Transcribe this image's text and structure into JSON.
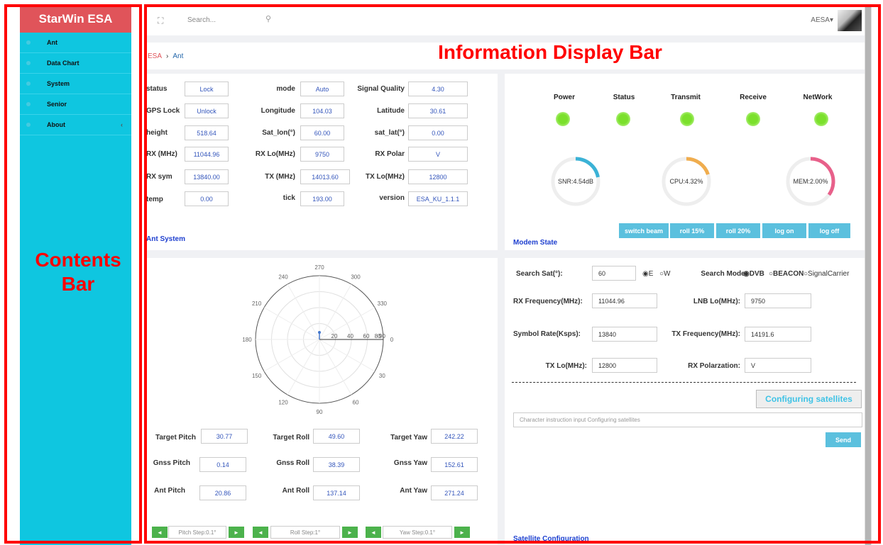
{
  "sidebar": {
    "brand": "StarWin ESA",
    "items": [
      {
        "label": "Ant"
      },
      {
        "label": "Data Chart"
      },
      {
        "label": "System"
      },
      {
        "label": "Senior"
      },
      {
        "label": "About",
        "chevron": "‹"
      }
    ]
  },
  "annotations": {
    "contents": "Contents Bar",
    "information": "Information Display Bar"
  },
  "topbar": {
    "search_placeholder": "Search...",
    "user": "AESA▾"
  },
  "breadcrumb": {
    "items": [
      "ESA",
      "Ant"
    ],
    "separator": "›"
  },
  "ant": {
    "title": "Ant System",
    "fields": [
      {
        "label": "status",
        "value": "Lock"
      },
      {
        "label": "mode",
        "value": "Auto"
      },
      {
        "label": "Signal Quality",
        "value": "4.30"
      },
      {
        "label": "GPS Lock",
        "value": "Unlock"
      },
      {
        "label": "Longitude",
        "value": "104.03"
      },
      {
        "label": "Latitude",
        "value": "30.61"
      },
      {
        "label": "height",
        "value": "518.64"
      },
      {
        "label": "Sat_lon(°)",
        "value": "60.00"
      },
      {
        "label": "sat_lat(°)",
        "value": "0.00"
      },
      {
        "label": "RX (MHz)",
        "value": "11044.96"
      },
      {
        "label": "RX Lo(MHz)",
        "value": "9750"
      },
      {
        "label": "RX Polar",
        "value": "V"
      },
      {
        "label": "RX sym",
        "value": "13840.00"
      },
      {
        "label": "TX (MHz)",
        "value": "14013.60"
      },
      {
        "label": "TX Lo(MHz)",
        "value": "12800"
      },
      {
        "label": "temp",
        "value": "0.00"
      },
      {
        "label": "tick",
        "value": "193.00"
      },
      {
        "label": "version",
        "value": "ESA_KU_1.1.1"
      }
    ]
  },
  "modem": {
    "title": "Modem State",
    "leds": [
      {
        "label": "Power"
      },
      {
        "label": "Status"
      },
      {
        "label": "Transmit"
      },
      {
        "label": "Receive"
      },
      {
        "label": "NetWork"
      }
    ],
    "gauges": [
      {
        "label": "SNR:4.54dB",
        "fraction": 0.22,
        "color": "#3bb2d6"
      },
      {
        "label": "CPU:4.32%",
        "fraction": 0.2,
        "color": "#f0ad4e"
      },
      {
        "label": "MEM:2.00%",
        "fraction": 0.35,
        "color": "#e8608a"
      }
    ],
    "buttons": [
      "switch beam",
      "roll 15%",
      "roll 20%",
      "log on",
      "log off"
    ]
  },
  "polar": {
    "angle_labels": [
      "270",
      "300",
      "330",
      "0",
      "30",
      "60",
      "90",
      "120",
      "150",
      "180",
      "210",
      "240"
    ],
    "radial_labels": [
      "20",
      "40",
      "60",
      "80",
      "90"
    ],
    "point": {
      "angle_deg": 90,
      "radius": 10
    }
  },
  "attitude": {
    "rows": [
      [
        {
          "label": "Target Pitch",
          "value": "30.77"
        },
        {
          "label": "Target Roll",
          "value": "49.60"
        },
        {
          "label": "Target Yaw",
          "value": "242.22"
        }
      ],
      [
        {
          "label": "Gnss Pitch",
          "value": "0.14"
        },
        {
          "label": "Gnss Roll",
          "value": "38.39"
        },
        {
          "label": "Gnss Yaw",
          "value": "152.61"
        }
      ],
      [
        {
          "label": "Ant Pitch",
          "value": "20.86"
        },
        {
          "label": "Ant Roll",
          "value": "137.14"
        },
        {
          "label": "Ant Yaw",
          "value": "271.24"
        }
      ]
    ],
    "steps": [
      "Pitch Step:0.1°",
      "Roll Step:1°",
      "Yaw Step:0.1°"
    ]
  },
  "satellite": {
    "title": "Satellite Configuration",
    "search_sat_label": "Search Sat(°):",
    "search_sat_value": "60",
    "dir_e": "◉E",
    "dir_w": "○W",
    "search_mode_label": "Search Mode:",
    "mode_dvb": "◉DVB",
    "mode_beacon": "○BEACON",
    "mode_signal": "○SignalCarrier",
    "rx_freq_label": "RX Frequency(MHz):",
    "rx_freq_value": "11044.96",
    "lnb_lo_label": "LNB Lo(MHz):",
    "lnb_lo_value": "9750",
    "symbol_rate_label": "Symbol Rate(Ksps):",
    "symbol_rate_value": "13840",
    "tx_freq_label": "TX Frequency(MHz):",
    "tx_freq_value": "14191.6",
    "tx_lo_label": "TX Lo(MHz):",
    "tx_lo_value": "12800",
    "rx_pol_label": "RX Polarzation:",
    "rx_pol_value": "V",
    "configure_button": "Configuring satellites",
    "command_placeholder": "Character instruction input Configuring satellites",
    "send_button": "Send"
  }
}
